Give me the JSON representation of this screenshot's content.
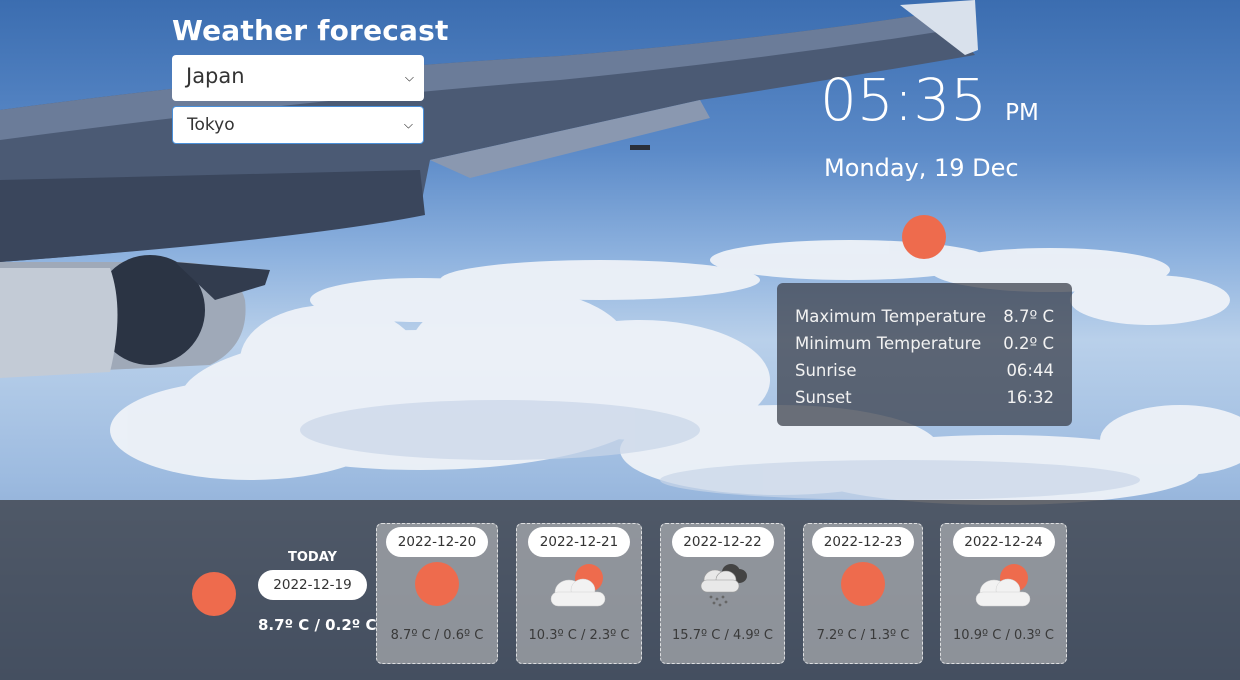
{
  "app": {
    "title": "Weather forecast"
  },
  "location": {
    "country": "Japan",
    "city": "Tokyo"
  },
  "clock": {
    "time": "05:35",
    "ampm": "PM",
    "date": "Monday, 19 Dec"
  },
  "current": {
    "icon": "sun-icon",
    "details": [
      {
        "label": "Maximum Temperature",
        "value": "8.7º C"
      },
      {
        "label": "Minimum Temperature",
        "value": "0.2º C"
      },
      {
        "label": "Sunrise",
        "value": "06:44"
      },
      {
        "label": "Sunset",
        "value": "16:32"
      }
    ]
  },
  "today": {
    "label": "TODAY",
    "date": "2022-12-19",
    "temps": "8.7º C / 0.2º C",
    "icon": "sun-icon"
  },
  "forecast": [
    {
      "date": "2022-12-20",
      "icon": "sun-icon",
      "temps": "8.7º C / 0.6º C"
    },
    {
      "date": "2022-12-21",
      "icon": "partly-cloudy-icon",
      "temps": "10.3º C / 2.3º C"
    },
    {
      "date": "2022-12-22",
      "icon": "rain-cloud-icon",
      "temps": "15.7º C / 4.9º C"
    },
    {
      "date": "2022-12-23",
      "icon": "sun-icon",
      "temps": "7.2º C / 1.3º C"
    },
    {
      "date": "2022-12-24",
      "icon": "partly-cloudy-icon",
      "temps": "10.9º C / 0.3º C"
    }
  ],
  "colors": {
    "sun": "#ee6b4d",
    "panel": "#373c46",
    "card": "#c8c8c8"
  }
}
